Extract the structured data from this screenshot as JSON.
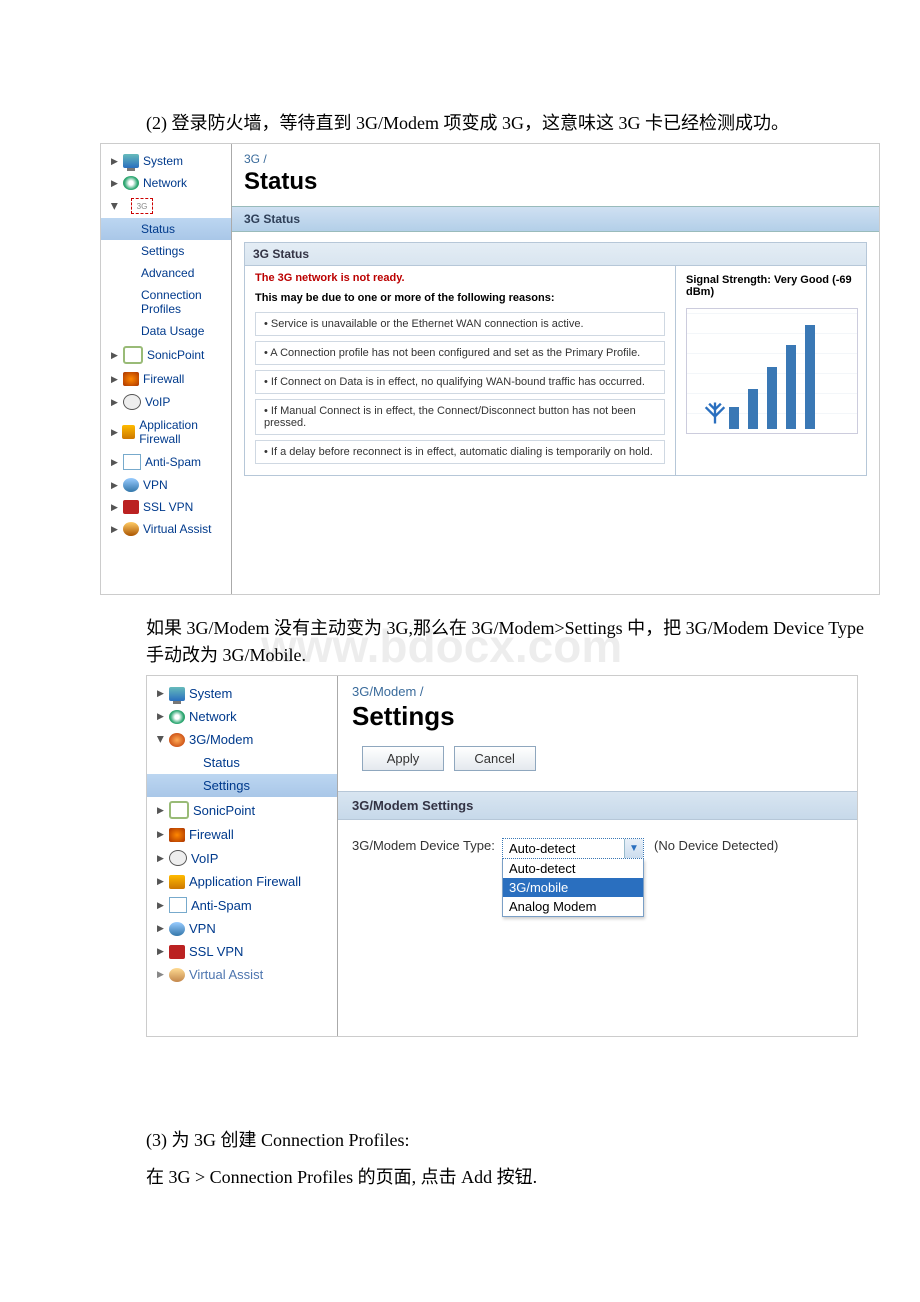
{
  "para1": "(2) 登录防火墙，等待直到 3G/Modem 项变成 3G，这意味这 3G 卡已经检测成功。",
  "watermark": "www.bdocx.com",
  "shot1": {
    "nav_top": [
      {
        "label": "System"
      },
      {
        "label": "Network"
      },
      {
        "label": "3G",
        "expanded": true
      }
    ],
    "nav_sub": [
      "Status",
      "Settings",
      "Advanced",
      "Connection Profiles",
      "Data Usage"
    ],
    "nav_sub_selected": 0,
    "nav_more": [
      "SonicPoint",
      "Firewall",
      "VoIP",
      "Application Firewall",
      "Anti-Spam",
      "VPN",
      "SSL VPN",
      "Virtual Assist"
    ],
    "breadcrumb": "3G /",
    "title": "Status",
    "section_bar": "3G Status",
    "panel_head": "3G Status",
    "not_ready": "The 3G network is not ready.",
    "reason_head": "This may be due to one or more of the following reasons:",
    "bullets": [
      "• Service is unavailable or the Ethernet WAN connection is active.",
      "• A Connection profile has not been configured and set as the Primary Profile.",
      "• If Connect on Data is in effect, no qualifying WAN-bound traffic has occurred.",
      "• If Manual Connect is in effect, the Connect/Disconnect button has not been pressed.",
      "• If a delay before reconnect is in effect, automatic dialing is temporarily on hold."
    ],
    "signal_label": "Signal Strength:  Very Good (-69 dBm)"
  },
  "para2": "如果 3G/Modem 没有主动变为 3G,那么在 3G/Modem>Settings 中，把 3G/Modem Device Type 手动改为 3G/Mobile.",
  "shot2": {
    "nav_top": [
      {
        "label": "System"
      },
      {
        "label": "Network"
      },
      {
        "label": "3G/Modem",
        "expanded": true
      }
    ],
    "nav_sub": [
      "Status",
      "Settings"
    ],
    "nav_sub_selected": 1,
    "nav_more": [
      "SonicPoint",
      "Firewall",
      "VoIP",
      "Application Firewall",
      "Anti-Spam",
      "VPN",
      "SSL VPN",
      "Virtual Assist"
    ],
    "breadcrumb": "3G/Modem /",
    "title": "Settings",
    "apply": "Apply",
    "cancel": "Cancel",
    "section_bar": "3G/Modem Settings",
    "field_label": "3G/Modem Device Type:",
    "dd_selected": "Auto-detect",
    "dd_options": [
      "Auto-detect",
      "3G/mobile",
      "Analog Modem"
    ],
    "dd_highlight": 1,
    "after": "(No Device Detected)"
  },
  "para3": "(3) 为 3G 创建 Connection Profiles:",
  "para4": "在 3G > Connection Profiles 的页面, 点击 Add 按钮."
}
